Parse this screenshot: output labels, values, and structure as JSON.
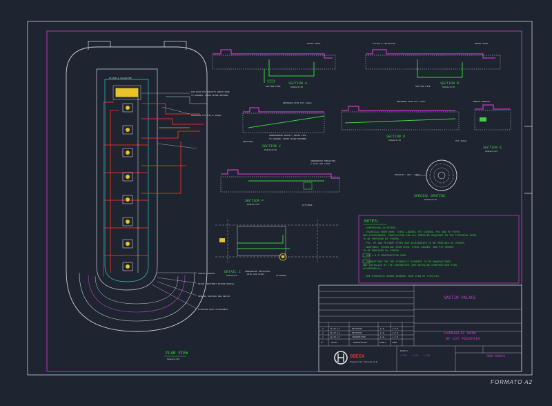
{
  "sheet": {
    "format_label": "FORMATO A2",
    "colors": {
      "background": "#1e2430",
      "frame": "#cfd3da",
      "magenta": "#c23fc4",
      "green": "#3fd23f",
      "red": "#d8322a",
      "cyan": "#37c9c9",
      "yellow": "#e8c42a",
      "white": "#e6e8ec",
      "gray": "#8a8f99"
    }
  },
  "plan": {
    "title": "PLAN VIEW",
    "scale": "SCALE=1/50",
    "annotations": [
      "FILTER & COLLECTOR",
      "DRAINAGE PIPE",
      "FOR MAIN PVC GRAVITY DRAIN PIPE",
      "TO GENERAL STORM WATER NETWORK",
      "DRAINAGE PVC 110 & 110mm",
      "CABLES CONDUIT",
      "WATER TREATMENT RETURN NOZZLE",
      "SPECIAL GRATING SEE DETAIL",
      "FLOATING PEAT ATTACHMENT"
    ]
  },
  "sections": [
    {
      "id": "section-a",
      "label": "SECTION A",
      "scale": "SCALE=1/25",
      "notes": [
        "WATER LEVEL",
        "SUCTION PIPE"
      ]
    },
    {
      "id": "section-b",
      "label": "SECTION B",
      "scale": "SCALE=1/25",
      "notes": [
        "FILTER & COLLECTOR",
        "WATER LEVEL",
        "SUCTION PIPE"
      ]
    },
    {
      "id": "section-c",
      "label": "SECTION C",
      "scale": "SCALE=1/25",
      "notes": [
        "DRAINAGE PIPE PVC 110mm",
        "UNDERGROUND GRAVITY DRAIN PIPE",
        "TO GENERAL STORM WATER NETWORK",
        "EMPTYING"
      ]
    },
    {
      "id": "section-d",
      "label": "SECTION D",
      "scale": "SCALE=1/25",
      "notes": [
        "DRAINAGE PIPE PVC 110mm"
      ]
    },
    {
      "id": "section-e",
      "label": "SECTION E",
      "scale": "SCALE=1/25",
      "notes": [
        "CABLES CONDUIT",
        "PVC 110mm"
      ]
    },
    {
      "id": "section-f",
      "label": "SECTION F",
      "scale": "SCALE=1/25",
      "notes": [
        "UNDERWATER PROJECTOR",
        "2 WITH LED LIGHT",
        "FITTINGS"
      ]
    },
    {
      "id": "special-grating",
      "label": "SPECIAL GRATING",
      "scale": "SCALE=1/10",
      "notes": [
        "MATERIAL: ABS / INOX"
      ]
    },
    {
      "id": "detail-1",
      "label": "DETAIL 1",
      "scale": "SCALE=1/5",
      "notes": [
        "UNDERWATER PROJECTOR",
        "WITH LED LIGHT",
        "FITTINGS"
      ]
    }
  ],
  "notes": {
    "heading": "NOTES:",
    "items": [
      "- DIMENSIONS IN METERS.",
      "- TECHNICAL ROOM DOOR, STEEL LADDER, PIT COVERS, PVC AND PE PIPES",
      "  AND ACCESSORIES, VENTILATION AND ALL SERVICES REQUIRED IN THE TECHNICAL ROOM",
      "  TO BE PROVIDED BY OTHERS.",
      "- PVC, PE AND PE/HDPE PIPES AND ACCESSORIES TO BE PROVIDED BY OTHERS.",
      "- GRATINGS, TECHNICAL ROOM DOOR, STEEL LADDER, AND PIT COVERS",
      "  TO BE PROVIDED BY OTHERS.",
      "- ONE 4 & 5 CONSTRUCTION CODE.",
      "- FOUNDATIONS FOR THE HYDRAULIC ELEMENTS TO BE MANUFACTURED",
      "  AND INSTALLED BY THE CONTRACTOR (SEE DETAILED CONSTRUCTION PLAN",
      "  ACCORDINGLY).",
      "- SEE HYDRAULIC WORKS GENERAL PLAN VIEW AT 1/50-011"
    ]
  },
  "title_block": {
    "project": "SASTIM PALACE",
    "drawing_title": "HYDRAULIC WORK",
    "drawing_subtitle": "OF 1ST FOUNTAIN",
    "drawing_number": "SWB-00063",
    "company": "OBECA",
    "company_sub": "Ingeniería Técnica S.A.",
    "scale_label": "ESCALA",
    "scale_value": "1/50 - 1/25 - 1/10",
    "revisions": [
      {
        "no": "3",
        "date": "15-07-11",
        "desc": "REVISION",
        "by": "E.B.",
        "chk": "J.R.M."
      },
      {
        "no": "2",
        "date": "06-07-11",
        "desc": "REVISION",
        "by": "E.B.",
        "chk": "J.R.M."
      },
      {
        "no": "1",
        "date": "18-06-11",
        "desc": "INFORMATION",
        "by": "E.B.",
        "chk": "J.R.M."
      }
    ],
    "rev_headers": {
      "no": "Nº",
      "date": "FECHA",
      "desc": "DESCRIPCION",
      "by": "DIBUJ.",
      "chk": "COMP."
    }
  }
}
